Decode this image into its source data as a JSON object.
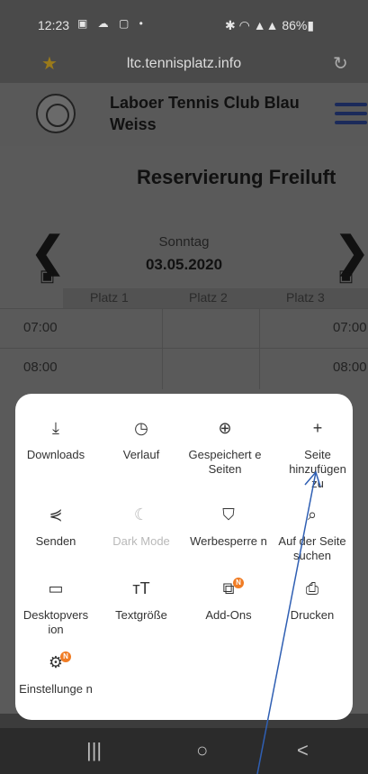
{
  "status_bar": {
    "time": "12:23",
    "left_icons": "▣ ☁ ▢ •",
    "right_icons": "✱ ◠ ▲▲ 86%▮"
  },
  "browser": {
    "url": "ltc.tennisplatz.info",
    "bookmark_icon": "star-icon",
    "reload_icon": "reload-icon"
  },
  "page": {
    "club_name": "Laboer Tennis Club Blau Weiss",
    "title": "Reservierung Freiluft",
    "day": "Sonntag",
    "date": "03.05.2020",
    "columns": [
      "Platz 1",
      "Platz 2",
      "Platz 3"
    ],
    "times": [
      "07:00",
      "08:00"
    ]
  },
  "menu": {
    "items": [
      {
        "label": "Downloads",
        "icon": "download-icon",
        "glyph": "⤓"
      },
      {
        "label": "Verlauf",
        "icon": "history-icon",
        "glyph": "◷"
      },
      {
        "label": "Gespeichert e Seiten",
        "icon": "saved-pages-icon",
        "glyph": "⊕"
      },
      {
        "label": "Seite hinzufügen zu",
        "icon": "plus-icon",
        "glyph": "+"
      },
      {
        "label": "Senden",
        "icon": "share-icon",
        "glyph": "⋞"
      },
      {
        "label": "Dark Mode",
        "icon": "moon-icon",
        "glyph": "☾"
      },
      {
        "label": "Werbesperre n",
        "icon": "shield-icon",
        "glyph": "⛉"
      },
      {
        "label": "Auf der Seite suchen",
        "icon": "find-in-page-icon",
        "glyph": "⌕"
      },
      {
        "label": "Desktopvers ion",
        "icon": "desktop-icon",
        "glyph": "▭"
      },
      {
        "label": "Textgröße",
        "icon": "text-size-icon",
        "glyph": "ᴛT"
      },
      {
        "label": "Add-Ons",
        "icon": "addons-icon",
        "glyph": "⧉"
      },
      {
        "label": "Drucken",
        "icon": "print-icon",
        "glyph": "⎙"
      },
      {
        "label": "Einstellunge n",
        "icon": "gear-icon",
        "glyph": "⚙"
      }
    ],
    "badge": "N"
  },
  "navbar": {
    "recents": "|||",
    "home": "○",
    "back": "<"
  },
  "colors": {
    "badge": "#f07c24",
    "annotation": "#2f5fb3",
    "menu_bg": "#ffffff"
  }
}
